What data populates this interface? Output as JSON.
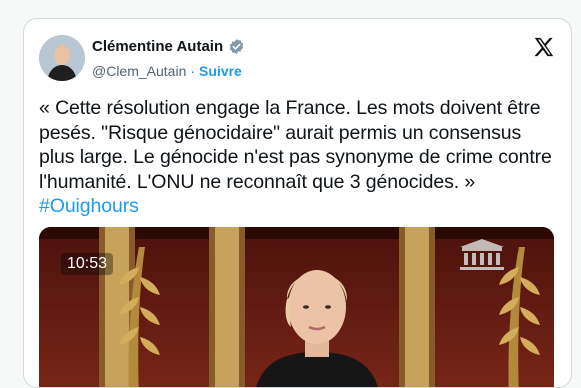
{
  "author": {
    "name": "Clémentine Autain",
    "handle": "@Clem_Autain",
    "separator": "·",
    "follow_label": "Suivre",
    "verified": true
  },
  "tweet": {
    "text": "« Cette résolution engage la France. Les mots doivent être pesés. \"Risque génocidaire\" aurait permis un consensus plus large. Le génocide n'est pas synonyme de crime contre l'humanité. L'ONU ne reconnaît que 3 génocides. »",
    "hashtag": "#Ouighours"
  },
  "media": {
    "timestamp": "10:53"
  },
  "icons": {
    "brand": "x-logo-icon",
    "badge": "verified-badge-icon"
  },
  "colors": {
    "link": "#1d9bf0",
    "text": "#0f1419",
    "muted": "#536471"
  }
}
